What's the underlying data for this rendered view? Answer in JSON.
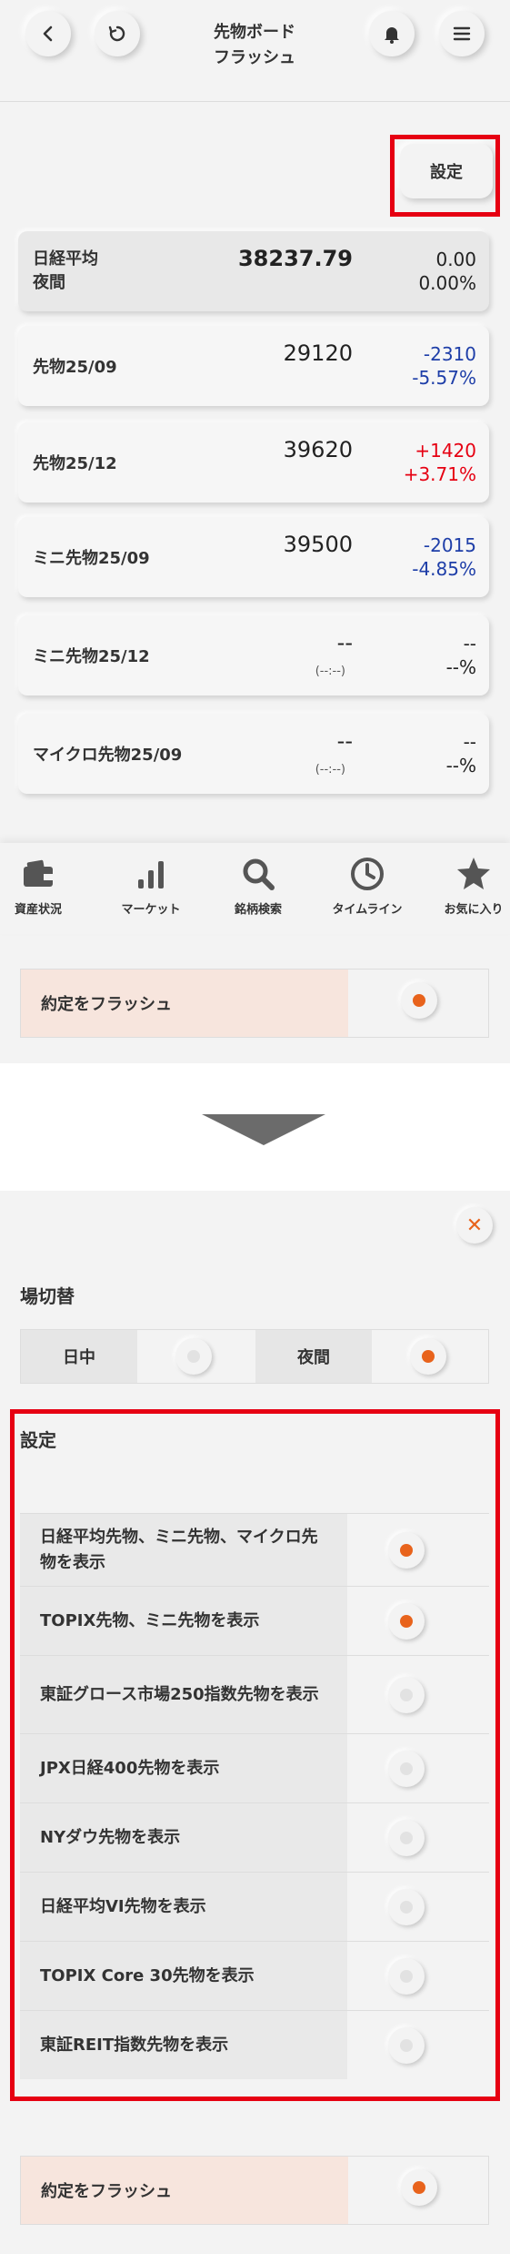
{
  "header": {
    "title": "先物ボード\nフラッシュ",
    "settings_label": "設定"
  },
  "quotes": [
    {
      "name": "日経平均\n夜間",
      "price": "38237.79",
      "change": "0.00",
      "change_pct": "0.00%",
      "direction": "neutral"
    },
    {
      "name": "先物25/09",
      "price": "29120",
      "change": "-2310",
      "change_pct": "-5.57%",
      "direction": "down"
    },
    {
      "name": "先物25/12",
      "price": "39620",
      "change": "+1420",
      "change_pct": "+3.71%",
      "direction": "up"
    },
    {
      "name": "ミニ先物25/09",
      "price": "39500",
      "change": "-2015",
      "change_pct": "-4.85%",
      "direction": "down"
    },
    {
      "name": "ミニ先物25/12",
      "price": "--",
      "time": "(--:--)",
      "change": "--",
      "change_pct": "--%",
      "direction": "neutral"
    },
    {
      "name": "マイクロ先物25/09",
      "price": "--",
      "time": "(--:--)",
      "change": "--",
      "change_pct": "--%",
      "direction": "neutral"
    }
  ],
  "bottom_nav": [
    {
      "label": "資産状況",
      "icon": "wallet-icon"
    },
    {
      "label": "マーケット",
      "icon": "bar-chart-icon"
    },
    {
      "label": "銘柄検索",
      "icon": "search-icon"
    },
    {
      "label": "タイムライン",
      "icon": "clock-icon"
    },
    {
      "label": "お気に入り",
      "icon": "star-icon"
    }
  ],
  "flash_top": {
    "label": "約定をフラッシュ",
    "selected": true
  },
  "settings_panel": {
    "session_title": "場切替",
    "session_options": [
      {
        "label": "日中",
        "selected": false
      },
      {
        "label": "夜間",
        "selected": true
      }
    ],
    "settings_title": "設定",
    "options": [
      {
        "label": "日経平均先物、ミニ先物、マイクロ先物を表示",
        "selected": true
      },
      {
        "label": "TOPIX先物、ミニ先物を表示",
        "selected": true
      },
      {
        "label": "東証グロース市場250指数先物を表示",
        "selected": false
      },
      {
        "label": "JPX日経400先物を表示",
        "selected": false
      },
      {
        "label": "NYダウ先物を表示",
        "selected": false
      },
      {
        "label": "日経平均VI先物を表示",
        "selected": false
      },
      {
        "label": "TOPIX Core 30先物を表示",
        "selected": false
      },
      {
        "label": "東証REIT指数先物を表示",
        "selected": false
      }
    ],
    "flash_label": "約定をフラッシュ",
    "flash_selected": true
  },
  "colors": {
    "accent": "#e8631c",
    "highlight_box": "#e60012",
    "up": "#e60012",
    "down": "#1e3ea8"
  }
}
